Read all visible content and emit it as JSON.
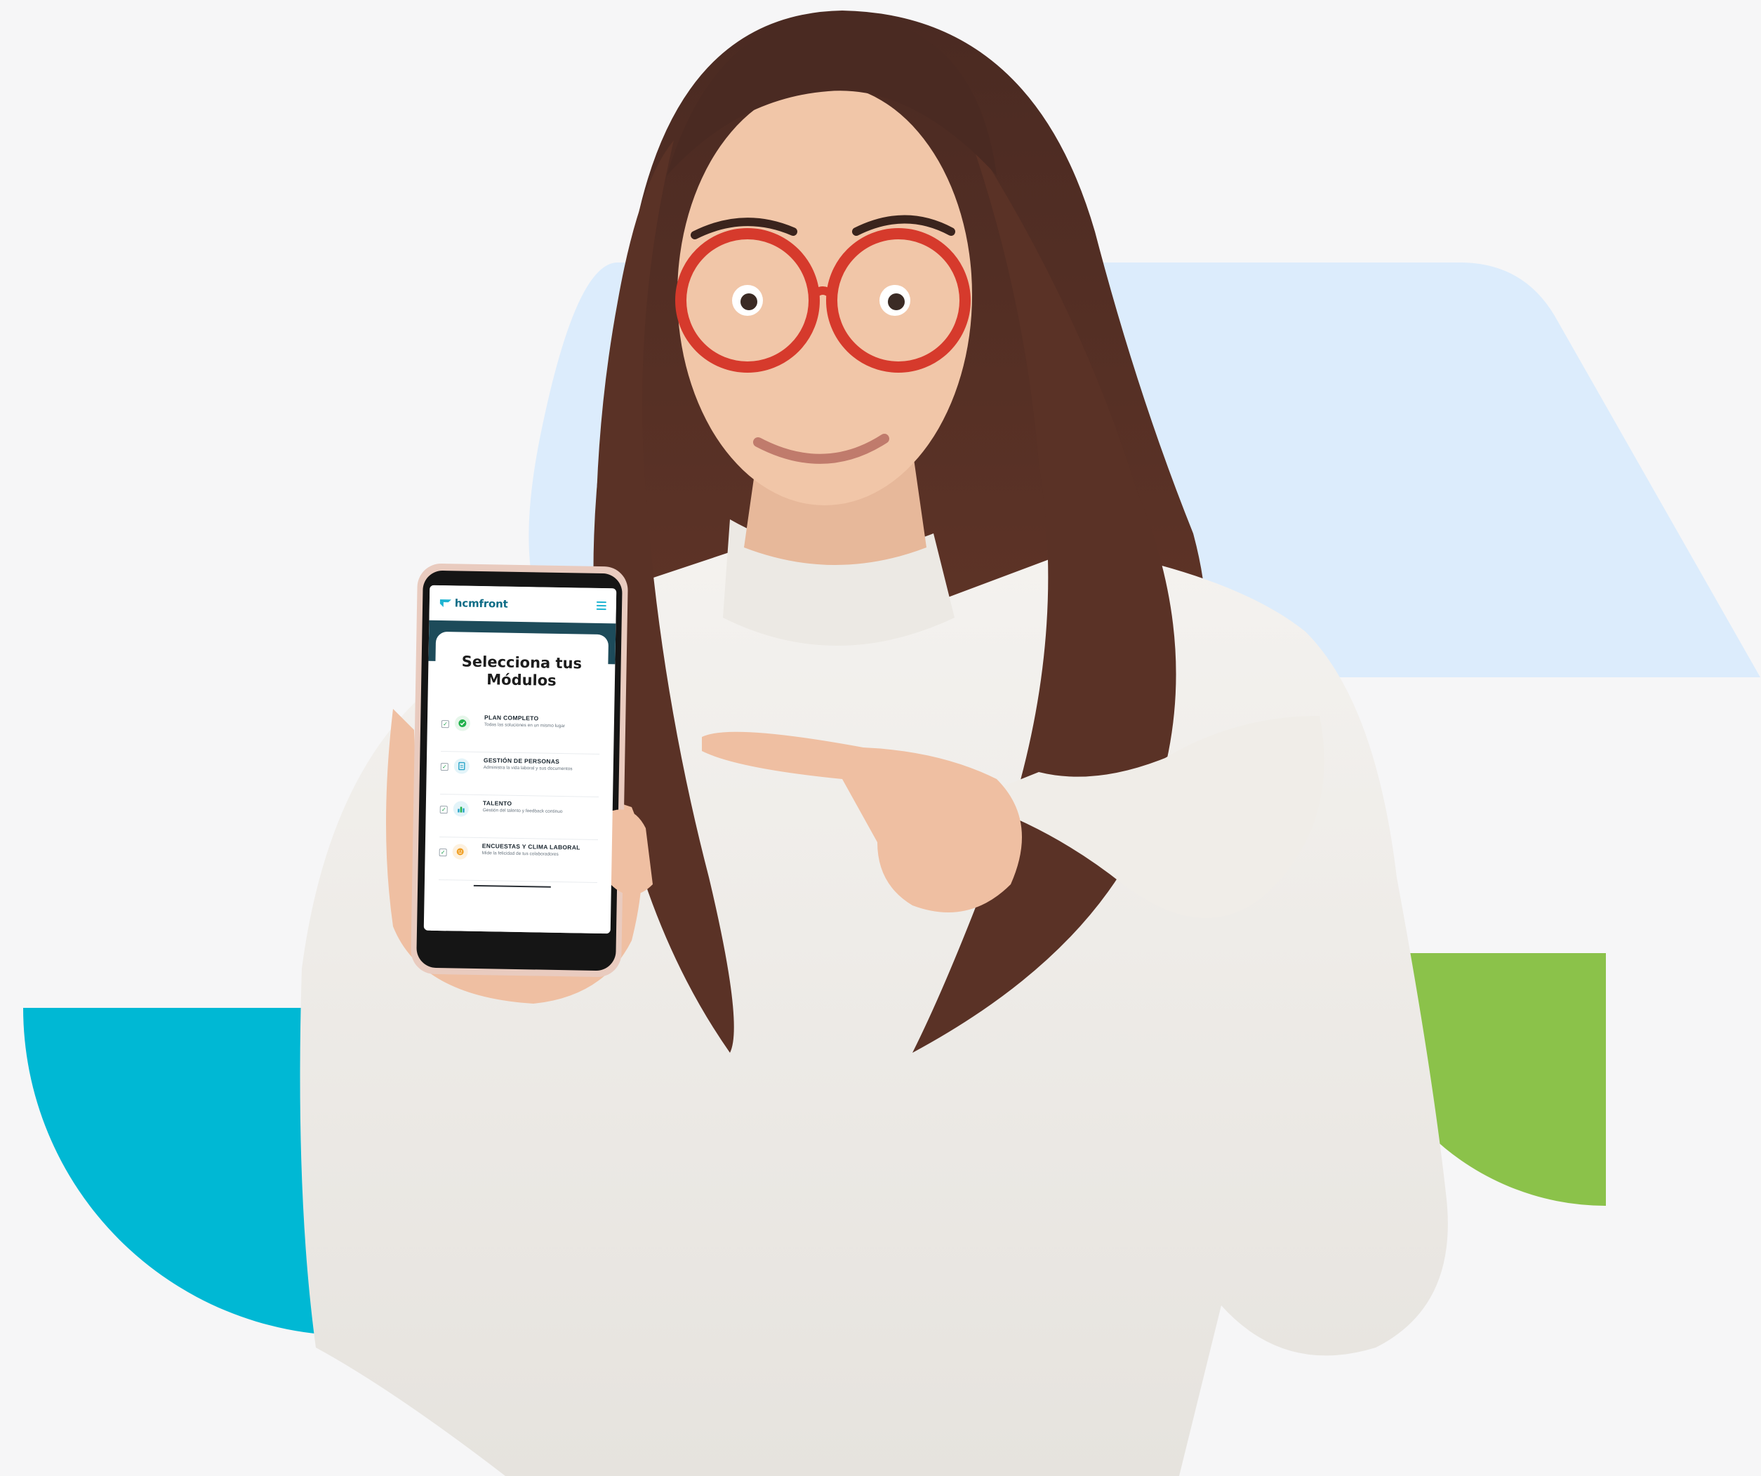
{
  "phone": {
    "app": {
      "brand": "hcmfront",
      "title": "Selecciona tus Módulos",
      "modules": [
        {
          "title": "PLAN COMPLETO",
          "desc": "Todas las soluciones en un mismo lugar",
          "icon": "check-shield-icon",
          "color": "#22b14c"
        },
        {
          "title": "GESTIÓN DE PERSONAS",
          "desc": "Administra la vida laboral y sus documentos",
          "icon": "document-icon",
          "color": "#2aa5c9"
        },
        {
          "title": "TALENTO",
          "desc": "Gestión del talento y feedback continuo",
          "icon": "talent-icon",
          "color": "#2aa5c9"
        },
        {
          "title": "ENCUESTAS Y CLIMA LABORAL",
          "desc": "Mide la felicidad de tus colaboradores",
          "icon": "survey-icon",
          "color": "#f1a22a"
        }
      ]
    }
  },
  "colors": {
    "background": "#f6f6f7",
    "light_blue_shape": "#dcecfc",
    "cyan_shape": "#00b8d4",
    "green_shape": "#8bc24a"
  }
}
